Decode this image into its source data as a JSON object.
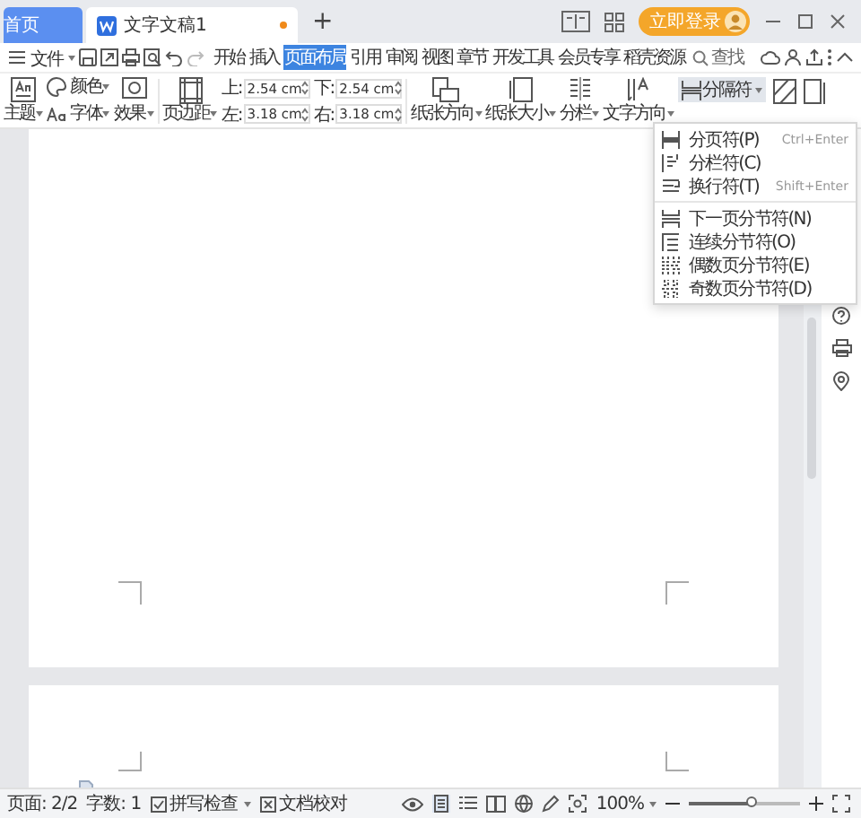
{
  "tabs": [
    {
      "label": "首页",
      "kind": "home",
      "selected": false
    },
    {
      "label": "文字文稿1",
      "kind": "doc",
      "selected": true
    }
  ],
  "new_tab": "+",
  "login_button": "立即登录",
  "menu": {
    "file": "文件",
    "items": [
      {
        "label": "开始",
        "selected": false
      },
      {
        "label": "插入",
        "selected": false
      },
      {
        "label": "页面布局",
        "selected": true
      },
      {
        "label": "引用",
        "selected": false
      },
      {
        "label": "审阅",
        "selected": false
      },
      {
        "label": "视图",
        "selected": false
      },
      {
        "label": "章节",
        "selected": false
      },
      {
        "label": "开发工具",
        "selected": false
      },
      {
        "label": "会员专享",
        "selected": false
      },
      {
        "label": "稻壳资源",
        "selected": false
      }
    ],
    "search": "查找"
  },
  "ribbon": {
    "theme": "主题",
    "color_label": "颜色",
    "font": "字体",
    "effect": "效果",
    "margin": "页边距",
    "margins": [
      {
        "label": "上:",
        "value": "2.54 cm"
      },
      {
        "label": "下:",
        "value": "2.54 cm"
      },
      {
        "label": "左:",
        "value": "3.18 cm"
      },
      {
        "label": "右:",
        "value": "3.18 cm"
      }
    ],
    "buttons": [
      {
        "label": "纸张方向",
        "kind": "orientation"
      },
      {
        "label": "纸张大小",
        "kind": "size"
      },
      {
        "label": "分栏",
        "kind": "columns"
      },
      {
        "label": "文字方向",
        "kind": "direction"
      }
    ],
    "separator": {
      "label": "分隔符",
      "expanded": true
    }
  },
  "dropdown": {
    "groups": [
      [
        {
          "label": "分页符(P)",
          "shortcut": "Ctrl+Enter",
          "kind": "page"
        },
        {
          "label": "分栏符(C)",
          "kind": "column"
        },
        {
          "label": "换行符(T)",
          "shortcut": "Shift+Enter",
          "kind": "line"
        }
      ],
      [
        {
          "label": "下一页分节符(N)",
          "kind": "next"
        },
        {
          "label": "连续分节符(O)",
          "kind": "continuous"
        },
        {
          "label": "偶数页分节符(E)",
          "kind": "even"
        },
        {
          "label": "奇数页分节符(D)",
          "kind": "odd"
        }
      ]
    ]
  },
  "status_bar": {
    "page": "页面: 2/2",
    "words": "字数: 1",
    "spell_check": "拼写检查",
    "proofread": "文档校对",
    "zoom": "100%",
    "zoom_slider": {
      "level": 0.56
    }
  }
}
